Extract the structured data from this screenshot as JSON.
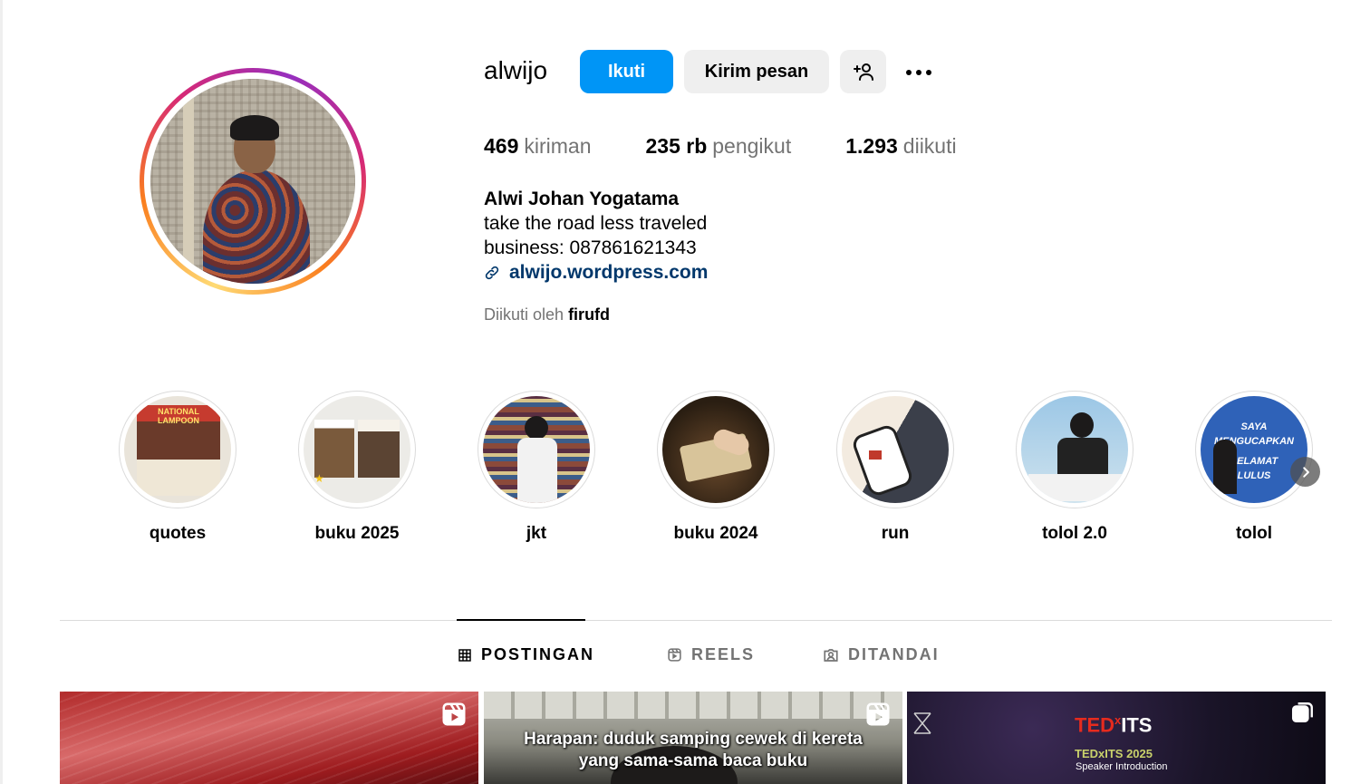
{
  "profile": {
    "username": "alwijo",
    "follow_label": "Ikuti",
    "message_label": "Kirim pesan",
    "stats": {
      "posts_count": "469",
      "posts_label": "kiriman",
      "followers_count": "235 rb",
      "followers_label": "pengikut",
      "following_count": "1.293",
      "following_label": "diikuti"
    },
    "full_name": "Alwi Johan Yogatama",
    "bio_line1": "take the road less traveled",
    "bio_line2": "business: 087861621343",
    "link": "alwijo.wordpress.com",
    "followed_by_prefix": "Diikuti oleh",
    "followed_by_user": "firufd"
  },
  "highlights": [
    {
      "label": "quotes"
    },
    {
      "label": "buku 2025"
    },
    {
      "label": "jkt"
    },
    {
      "label": "buku 2024"
    },
    {
      "label": "run"
    },
    {
      "label": "tolol 2.0"
    },
    {
      "label": "tolol"
    }
  ],
  "highlight_texts": {
    "quotes_masthead": "NATIONAL LAMPOON",
    "tolol_banner1": "SAYA",
    "tolol_banner2": "MENGUCAPKAN",
    "tolol_banner3": "SELAMAT",
    "tolol_banner4": "LULUS"
  },
  "tabs": [
    {
      "label": "POSTINGAN",
      "active": true
    },
    {
      "label": "REELS",
      "active": false
    },
    {
      "label": "DITANDAI",
      "active": false
    }
  ],
  "posts": {
    "post2_caption_line1": "Harapan: duduk samping cewek di kereta",
    "post2_caption_line2": "yang sama-sama baca buku",
    "post3_brand_ted": "TED",
    "post3_brand_x": "x",
    "post3_brand_its": "ITS",
    "post3_sub": "TEDxITS 2025",
    "post3_sub2": "Speaker Introduction"
  },
  "colors": {
    "primary_button": "#0095f6",
    "secondary_button": "#efefef",
    "link": "#00376b",
    "muted_text": "#737373"
  }
}
